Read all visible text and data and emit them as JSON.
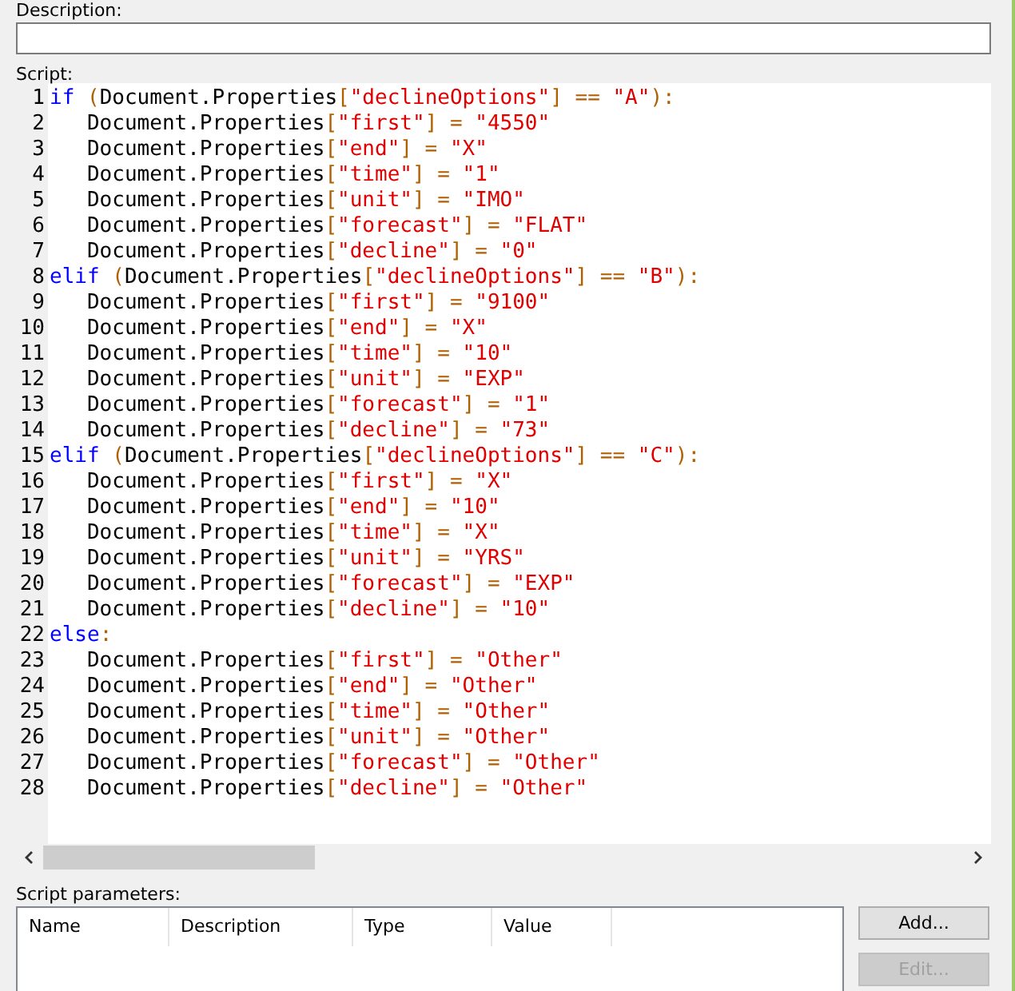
{
  "description": {
    "label": "Description:"
  },
  "script": {
    "label": "Script:",
    "lines": [
      {
        "number": "1",
        "tokens": [
          {
            "kind": "kw",
            "text": "if"
          },
          {
            "kind": "op",
            "text": " ("
          },
          {
            "kind": "plain",
            "text": "Document.Properties"
          },
          {
            "kind": "op",
            "text": "["
          },
          {
            "kind": "str",
            "text": "\"declineOptions\""
          },
          {
            "kind": "op",
            "text": "] == "
          },
          {
            "kind": "str",
            "text": "\"A\""
          },
          {
            "kind": "op",
            "text": "):"
          }
        ]
      },
      {
        "number": "2",
        "tokens": [
          {
            "kind": "plain",
            "text": "   Document.Properties"
          },
          {
            "kind": "op",
            "text": "["
          },
          {
            "kind": "str",
            "text": "\"first\""
          },
          {
            "kind": "op",
            "text": "] = "
          },
          {
            "kind": "str",
            "text": "\"4550\""
          }
        ]
      },
      {
        "number": "3",
        "tokens": [
          {
            "kind": "plain",
            "text": "   Document.Properties"
          },
          {
            "kind": "op",
            "text": "["
          },
          {
            "kind": "str",
            "text": "\"end\""
          },
          {
            "kind": "op",
            "text": "] = "
          },
          {
            "kind": "str",
            "text": "\"X\""
          }
        ]
      },
      {
        "number": "4",
        "tokens": [
          {
            "kind": "plain",
            "text": "   Document.Properties"
          },
          {
            "kind": "op",
            "text": "["
          },
          {
            "kind": "str",
            "text": "\"time\""
          },
          {
            "kind": "op",
            "text": "] = "
          },
          {
            "kind": "str",
            "text": "\"1\""
          }
        ]
      },
      {
        "number": "5",
        "tokens": [
          {
            "kind": "plain",
            "text": "   Document.Properties"
          },
          {
            "kind": "op",
            "text": "["
          },
          {
            "kind": "str",
            "text": "\"unit\""
          },
          {
            "kind": "op",
            "text": "] = "
          },
          {
            "kind": "str",
            "text": "\"IMO\""
          }
        ]
      },
      {
        "number": "6",
        "tokens": [
          {
            "kind": "plain",
            "text": "   Document.Properties"
          },
          {
            "kind": "op",
            "text": "["
          },
          {
            "kind": "str",
            "text": "\"forecast\""
          },
          {
            "kind": "op",
            "text": "] = "
          },
          {
            "kind": "str",
            "text": "\"FLAT\""
          }
        ]
      },
      {
        "number": "7",
        "tokens": [
          {
            "kind": "plain",
            "text": "   Document.Properties"
          },
          {
            "kind": "op",
            "text": "["
          },
          {
            "kind": "str",
            "text": "\"decline\""
          },
          {
            "kind": "op",
            "text": "] = "
          },
          {
            "kind": "str",
            "text": "\"0\""
          }
        ]
      },
      {
        "number": "8",
        "tokens": [
          {
            "kind": "kw",
            "text": "elif"
          },
          {
            "kind": "op",
            "text": " ("
          },
          {
            "kind": "plain",
            "text": "Document.Properties"
          },
          {
            "kind": "op",
            "text": "["
          },
          {
            "kind": "str",
            "text": "\"declineOptions\""
          },
          {
            "kind": "op",
            "text": "] == "
          },
          {
            "kind": "str",
            "text": "\"B\""
          },
          {
            "kind": "op",
            "text": "):"
          }
        ]
      },
      {
        "number": "9",
        "tokens": [
          {
            "kind": "plain",
            "text": "   Document.Properties"
          },
          {
            "kind": "op",
            "text": "["
          },
          {
            "kind": "str",
            "text": "\"first\""
          },
          {
            "kind": "op",
            "text": "] = "
          },
          {
            "kind": "str",
            "text": "\"9100\""
          }
        ]
      },
      {
        "number": "10",
        "tokens": [
          {
            "kind": "plain",
            "text": "   Document.Properties"
          },
          {
            "kind": "op",
            "text": "["
          },
          {
            "kind": "str",
            "text": "\"end\""
          },
          {
            "kind": "op",
            "text": "] = "
          },
          {
            "kind": "str",
            "text": "\"X\""
          }
        ]
      },
      {
        "number": "11",
        "tokens": [
          {
            "kind": "plain",
            "text": "   Document.Properties"
          },
          {
            "kind": "op",
            "text": "["
          },
          {
            "kind": "str",
            "text": "\"time\""
          },
          {
            "kind": "op",
            "text": "] = "
          },
          {
            "kind": "str",
            "text": "\"10\""
          }
        ]
      },
      {
        "number": "12",
        "tokens": [
          {
            "kind": "plain",
            "text": "   Document.Properties"
          },
          {
            "kind": "op",
            "text": "["
          },
          {
            "kind": "str",
            "text": "\"unit\""
          },
          {
            "kind": "op",
            "text": "] = "
          },
          {
            "kind": "str",
            "text": "\"EXP\""
          }
        ]
      },
      {
        "number": "13",
        "tokens": [
          {
            "kind": "plain",
            "text": "   Document.Properties"
          },
          {
            "kind": "op",
            "text": "["
          },
          {
            "kind": "str",
            "text": "\"forecast\""
          },
          {
            "kind": "op",
            "text": "] = "
          },
          {
            "kind": "str",
            "text": "\"1\""
          }
        ]
      },
      {
        "number": "14",
        "tokens": [
          {
            "kind": "plain",
            "text": "   Document.Properties"
          },
          {
            "kind": "op",
            "text": "["
          },
          {
            "kind": "str",
            "text": "\"decline\""
          },
          {
            "kind": "op",
            "text": "] = "
          },
          {
            "kind": "str",
            "text": "\"73\""
          }
        ]
      },
      {
        "number": "15",
        "tokens": [
          {
            "kind": "kw",
            "text": "elif"
          },
          {
            "kind": "op",
            "text": " ("
          },
          {
            "kind": "plain",
            "text": "Document.Properties"
          },
          {
            "kind": "op",
            "text": "["
          },
          {
            "kind": "str",
            "text": "\"declineOptions\""
          },
          {
            "kind": "op",
            "text": "] == "
          },
          {
            "kind": "str",
            "text": "\"C\""
          },
          {
            "kind": "op",
            "text": "):"
          }
        ]
      },
      {
        "number": "16",
        "tokens": [
          {
            "kind": "plain",
            "text": "   Document.Properties"
          },
          {
            "kind": "op",
            "text": "["
          },
          {
            "kind": "str",
            "text": "\"first\""
          },
          {
            "kind": "op",
            "text": "] = "
          },
          {
            "kind": "str",
            "text": "\"X\""
          }
        ]
      },
      {
        "number": "17",
        "tokens": [
          {
            "kind": "plain",
            "text": "   Document.Properties"
          },
          {
            "kind": "op",
            "text": "["
          },
          {
            "kind": "str",
            "text": "\"end\""
          },
          {
            "kind": "op",
            "text": "] = "
          },
          {
            "kind": "str",
            "text": "\"10\""
          }
        ]
      },
      {
        "number": "18",
        "tokens": [
          {
            "kind": "plain",
            "text": "   Document.Properties"
          },
          {
            "kind": "op",
            "text": "["
          },
          {
            "kind": "str",
            "text": "\"time\""
          },
          {
            "kind": "op",
            "text": "] = "
          },
          {
            "kind": "str",
            "text": "\"X\""
          }
        ]
      },
      {
        "number": "19",
        "tokens": [
          {
            "kind": "plain",
            "text": "   Document.Properties"
          },
          {
            "kind": "op",
            "text": "["
          },
          {
            "kind": "str",
            "text": "\"unit\""
          },
          {
            "kind": "op",
            "text": "] = "
          },
          {
            "kind": "str",
            "text": "\"YRS\""
          }
        ]
      },
      {
        "number": "20",
        "tokens": [
          {
            "kind": "plain",
            "text": "   Document.Properties"
          },
          {
            "kind": "op",
            "text": "["
          },
          {
            "kind": "str",
            "text": "\"forecast\""
          },
          {
            "kind": "op",
            "text": "] = "
          },
          {
            "kind": "str",
            "text": "\"EXP\""
          }
        ]
      },
      {
        "number": "21",
        "tokens": [
          {
            "kind": "plain",
            "text": "   Document.Properties"
          },
          {
            "kind": "op",
            "text": "["
          },
          {
            "kind": "str",
            "text": "\"decline\""
          },
          {
            "kind": "op",
            "text": "] = "
          },
          {
            "kind": "str",
            "text": "\"10\""
          }
        ]
      },
      {
        "number": "22",
        "tokens": [
          {
            "kind": "kw",
            "text": "else"
          },
          {
            "kind": "op",
            "text": ":"
          }
        ]
      },
      {
        "number": "23",
        "tokens": [
          {
            "kind": "plain",
            "text": "   Document.Properties"
          },
          {
            "kind": "op",
            "text": "["
          },
          {
            "kind": "str",
            "text": "\"first\""
          },
          {
            "kind": "op",
            "text": "] = "
          },
          {
            "kind": "str",
            "text": "\"Other\""
          }
        ]
      },
      {
        "number": "24",
        "tokens": [
          {
            "kind": "plain",
            "text": "   Document.Properties"
          },
          {
            "kind": "op",
            "text": "["
          },
          {
            "kind": "str",
            "text": "\"end\""
          },
          {
            "kind": "op",
            "text": "] = "
          },
          {
            "kind": "str",
            "text": "\"Other\""
          }
        ]
      },
      {
        "number": "25",
        "tokens": [
          {
            "kind": "plain",
            "text": "   Document.Properties"
          },
          {
            "kind": "op",
            "text": "["
          },
          {
            "kind": "str",
            "text": "\"time\""
          },
          {
            "kind": "op",
            "text": "] = "
          },
          {
            "kind": "str",
            "text": "\"Other\""
          }
        ]
      },
      {
        "number": "26",
        "tokens": [
          {
            "kind": "plain",
            "text": "   Document.Properties"
          },
          {
            "kind": "op",
            "text": "["
          },
          {
            "kind": "str",
            "text": "\"unit\""
          },
          {
            "kind": "op",
            "text": "] = "
          },
          {
            "kind": "str",
            "text": "\"Other\""
          }
        ]
      },
      {
        "number": "27",
        "tokens": [
          {
            "kind": "plain",
            "text": "   Document.Properties"
          },
          {
            "kind": "op",
            "text": "["
          },
          {
            "kind": "str",
            "text": "\"forecast\""
          },
          {
            "kind": "op",
            "text": "] = "
          },
          {
            "kind": "str",
            "text": "\"Other\""
          }
        ]
      },
      {
        "number": "28",
        "tokens": [
          {
            "kind": "plain",
            "text": "   Document.Properties"
          },
          {
            "kind": "op",
            "text": "["
          },
          {
            "kind": "str",
            "text": "\"decline\""
          },
          {
            "kind": "op",
            "text": "] = "
          },
          {
            "kind": "str",
            "text": "\"Other\""
          }
        ]
      }
    ]
  },
  "parameters": {
    "label": "Script parameters:",
    "columns": [
      "Name",
      "Description",
      "Type",
      "Value"
    ]
  },
  "buttons": [
    {
      "label": "Add...",
      "disabled": false
    },
    {
      "label": "Edit...",
      "disabled": true
    }
  ]
}
